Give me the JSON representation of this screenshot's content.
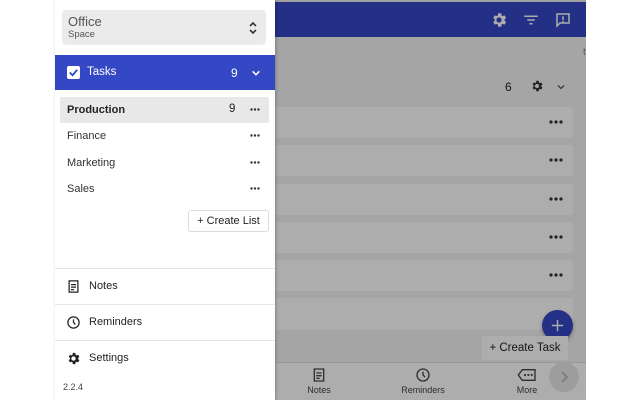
{
  "drawer": {
    "workspace": {
      "name": "Office",
      "subtitle": "Space"
    },
    "tasks": {
      "label": "Tasks",
      "count": "9"
    },
    "lists": [
      {
        "label": "Production",
        "count": "9",
        "active": true
      },
      {
        "label": "Finance",
        "count": "",
        "active": false
      },
      {
        "label": "Marketing",
        "count": "",
        "active": false
      },
      {
        "label": "Sales",
        "count": "",
        "active": false
      }
    ],
    "create_list_label": "+ Create List",
    "menu": [
      {
        "label": "Notes",
        "icon": "note-icon"
      },
      {
        "label": "Reminders",
        "icon": "clock-icon"
      },
      {
        "label": "Settings",
        "icon": "gear-icon"
      }
    ],
    "version": "2.2.4"
  },
  "app": {
    "header_icons": [
      "gear-icon",
      "filter-icon",
      "feedback-icon"
    ],
    "list_count": "6",
    "create_task_label": "+ Create Task",
    "bottom_nav": [
      {
        "label": "Notes",
        "icon": "note-icon"
      },
      {
        "label": "Reminders",
        "icon": "clock-icon"
      },
      {
        "label": "More",
        "icon": "more-icon"
      }
    ],
    "side_letter": "t"
  },
  "colors": {
    "accent": "#3448c5",
    "active_list_bg": "#e8e8e8",
    "workspace_bg": "#ebebeb"
  }
}
